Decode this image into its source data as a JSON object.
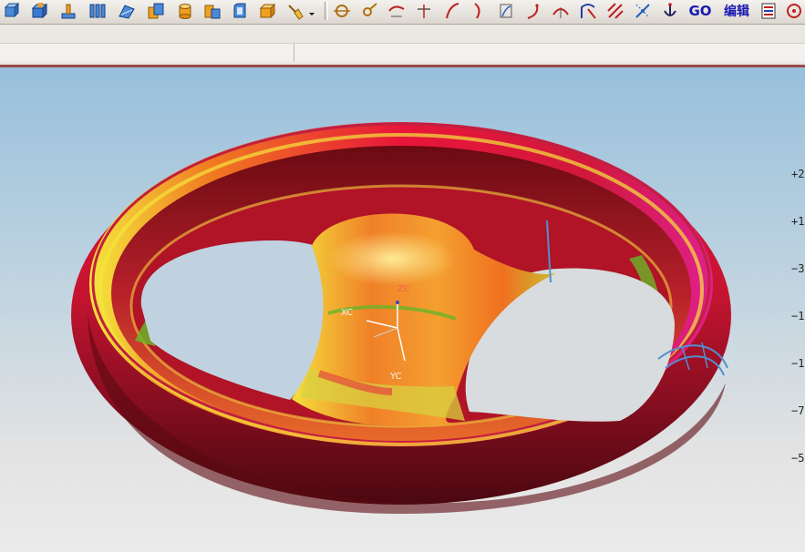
{
  "toolbar": {
    "icons": [
      "view-cube-icon",
      "block-icon",
      "extrude-icon",
      "planes-icon",
      "sweep-icon",
      "boolean-icon",
      "cylinder-icon",
      "cone-icon",
      "revolve-icon",
      "box-icon",
      "broom-icon",
      "dropdown-arrow-icon",
      "spline-icon",
      "point-icon",
      "curve-icon",
      "line-icon",
      "arc-icon",
      "trim-icon",
      "offset-icon",
      "bridge-icon",
      "fillet-icon",
      "section-icon",
      "hatch-icon",
      "measure-icon",
      "anchor-icon",
      "go-text-icon",
      "edit-text-icon",
      "layer-icon",
      "rotate-icon"
    ],
    "go_label": "GO",
    "edit_label": "编辑"
  },
  "colors": {
    "toolbar_bg": "#dcd8d0",
    "viewport_top": "#98c0dc",
    "viewport_bottom": "#ebebeb",
    "strip_line": "#9a4a44",
    "model_dark": "#5a0a10",
    "model_red": "#e8163a",
    "model_orange": "#f07820",
    "model_yellow": "#f4e63c",
    "model_green": "#6cb428",
    "model_magenta": "#e0208c",
    "curve_blue": "#5090d0"
  },
  "wcs": {
    "xc": "XC",
    "yc": "YC",
    "zc": "ZC"
  },
  "ruler": {
    "labels": [
      "+2",
      "+1",
      "−3",
      "−1",
      "−1",
      "−7",
      "−5"
    ]
  }
}
